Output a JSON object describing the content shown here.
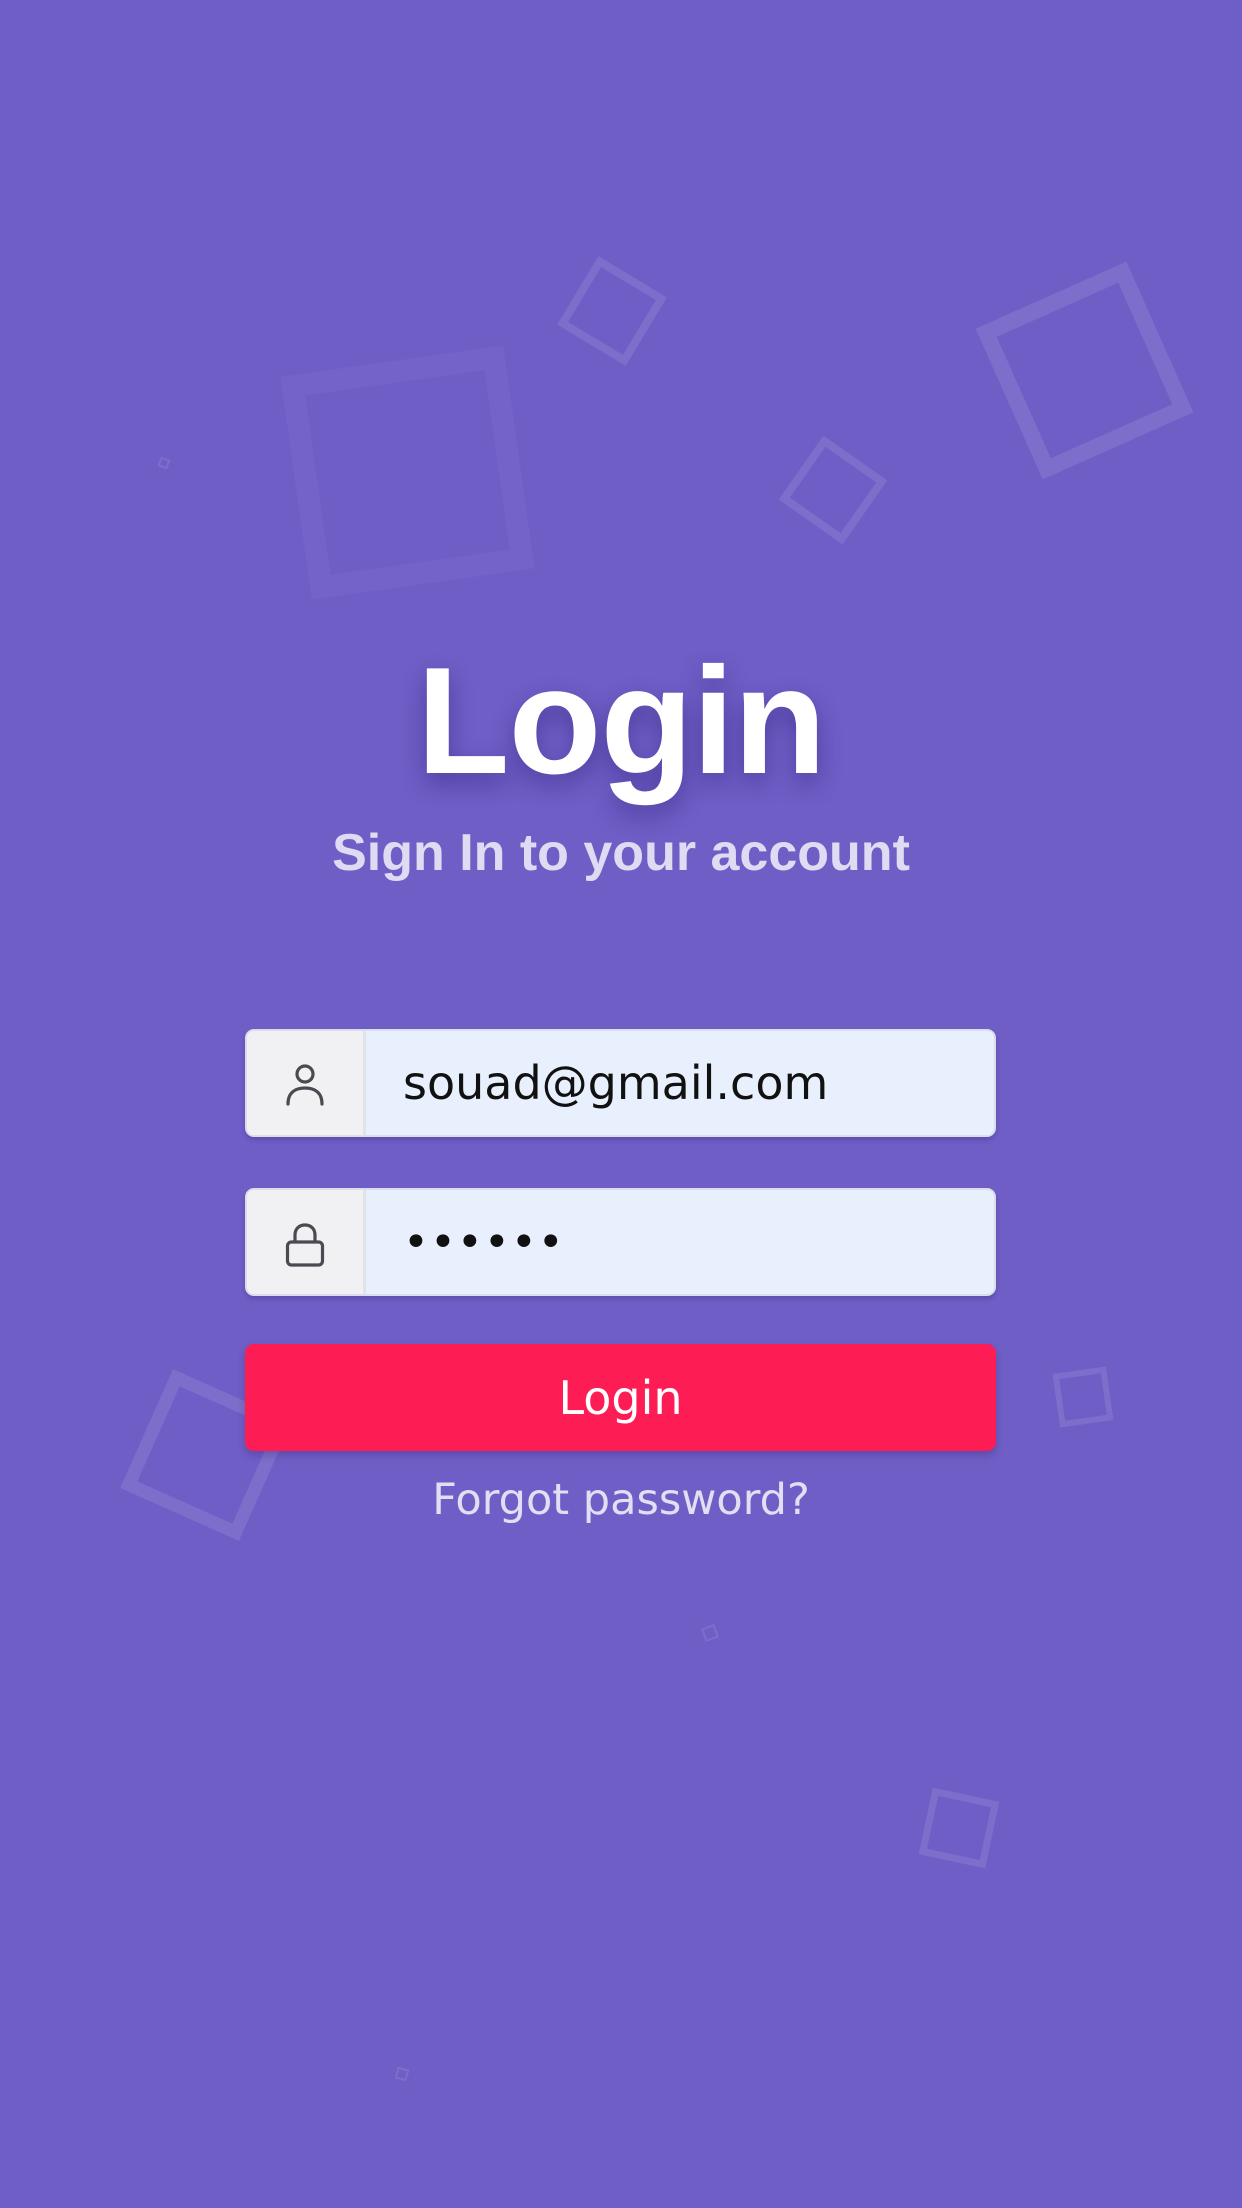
{
  "header": {
    "title": "Login",
    "subtitle": "Sign In to your account"
  },
  "form": {
    "email": {
      "icon": "user-icon",
      "value": "souad@gmail.com"
    },
    "password": {
      "icon": "lock-icon",
      "value": "••••••"
    },
    "submit_label": "Login",
    "forgot_label": "Forgot password?"
  },
  "colors": {
    "background": "#6f5ec6",
    "button": "#fe1c54",
    "input_background": "#e9f0fd",
    "icon_box_background": "#f1f1f3"
  }
}
